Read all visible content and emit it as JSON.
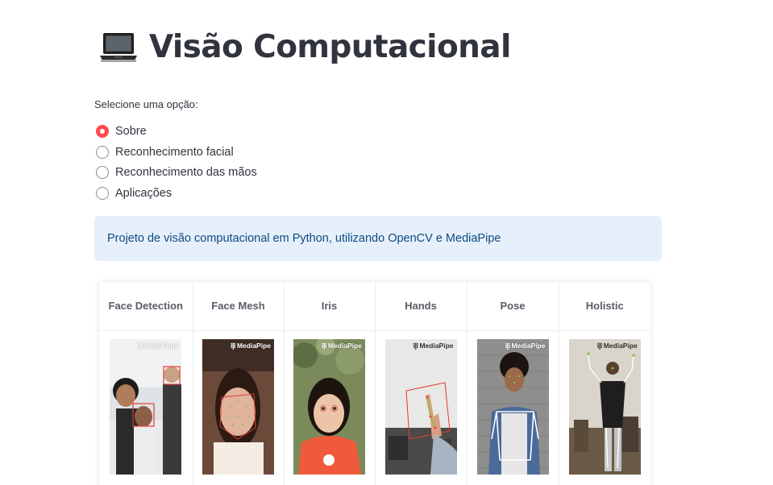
{
  "header": {
    "icon": "laptop-icon",
    "title": "Visão Computacional"
  },
  "selector": {
    "label": "Selecione uma opção:",
    "options": [
      {
        "label": "Sobre",
        "checked": true
      },
      {
        "label": "Reconhecimento facial",
        "checked": false
      },
      {
        "label": "Reconhecimento das mãos",
        "checked": false
      },
      {
        "label": "Aplicações",
        "checked": false
      }
    ]
  },
  "info": {
    "text": "Projeto de visão computacional em Python, utilizando OpenCV e MediaPipe"
  },
  "solutions_table": {
    "columns": [
      "Face Detection",
      "Face Mesh",
      "Iris",
      "Hands",
      "Pose",
      "Holistic"
    ],
    "logo_text": "MediaPipe",
    "logo_mark": "⁝|⁝"
  },
  "colors": {
    "accent": "#ff4b4b",
    "info_bg": "#e6f0fb",
    "info_text": "#0e4a80",
    "text": "#31333f"
  }
}
